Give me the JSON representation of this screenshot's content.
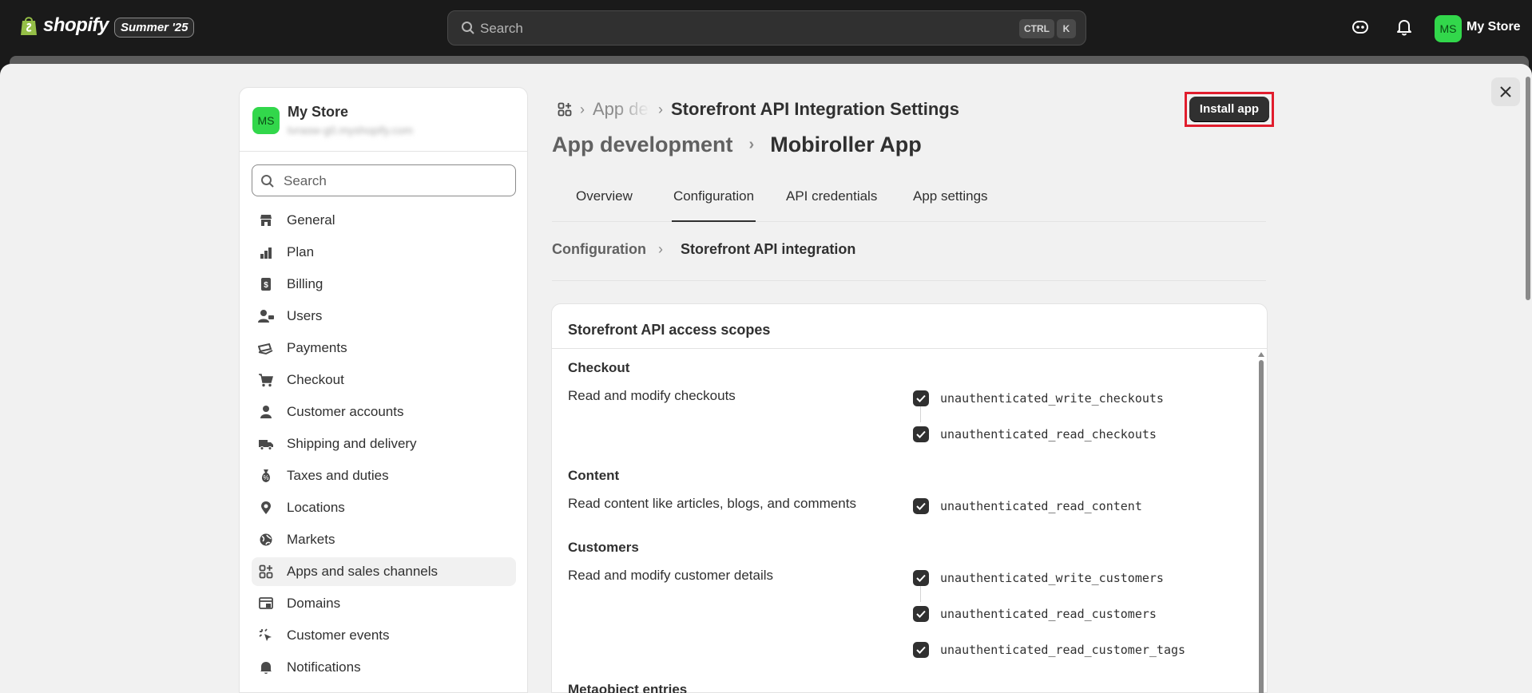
{
  "topbar": {
    "logo_text": "shopify",
    "edition_badge": "Summer '25",
    "search_placeholder": "Search",
    "shortcut_ctrl": "CTRL",
    "shortcut_k": "K",
    "avatar_initials": "MS",
    "store_name": "My Store"
  },
  "sidebar": {
    "avatar_initials": "MS",
    "store_name": "My Store",
    "store_url": "tvrasw-g0.myshopify.com",
    "search_placeholder": "Search",
    "items": [
      {
        "label": "General",
        "icon": "store-icon"
      },
      {
        "label": "Plan",
        "icon": "plan-icon"
      },
      {
        "label": "Billing",
        "icon": "billing-icon"
      },
      {
        "label": "Users",
        "icon": "users-icon"
      },
      {
        "label": "Payments",
        "icon": "payments-icon"
      },
      {
        "label": "Checkout",
        "icon": "cart-icon"
      },
      {
        "label": "Customer accounts",
        "icon": "person-icon"
      },
      {
        "label": "Shipping and delivery",
        "icon": "truck-icon"
      },
      {
        "label": "Taxes and duties",
        "icon": "taxes-icon"
      },
      {
        "label": "Locations",
        "icon": "location-icon"
      },
      {
        "label": "Markets",
        "icon": "globe-icon"
      },
      {
        "label": "Apps and sales channels",
        "icon": "apps-icon",
        "active": true
      },
      {
        "label": "Domains",
        "icon": "domains-icon"
      },
      {
        "label": "Customer events",
        "icon": "cursor-icon"
      },
      {
        "label": "Notifications",
        "icon": "bell-icon"
      }
    ]
  },
  "header": {
    "crumb_faded": "App development",
    "crumb_current": "Storefront API Integration Settings",
    "install_label": "Install app",
    "title_parent": "App development",
    "title_app": "Mobiroller App"
  },
  "tabs": [
    {
      "label": "Overview"
    },
    {
      "label": "Configuration",
      "active": true
    },
    {
      "label": "API credentials"
    },
    {
      "label": "App settings"
    }
  ],
  "subcrumb": {
    "parent": "Configuration",
    "current": "Storefront API integration"
  },
  "card": {
    "title": "Storefront API access scopes",
    "sections": [
      {
        "title": "Checkout",
        "description": "Read and modify checkouts",
        "scopes": [
          {
            "name": "unauthenticated_write_checkouts",
            "checked": true
          },
          {
            "name": "unauthenticated_read_checkouts",
            "checked": true
          }
        ]
      },
      {
        "title": "Content",
        "description": "Read content like articles, blogs, and comments",
        "scopes": [
          {
            "name": "unauthenticated_read_content",
            "checked": true
          }
        ]
      },
      {
        "title": "Customers",
        "description": "Read and modify customer details",
        "scopes": [
          {
            "name": "unauthenticated_write_customers",
            "checked": true
          },
          {
            "name": "unauthenticated_read_customers",
            "checked": true
          },
          {
            "name": "unauthenticated_read_customer_tags",
            "checked": true
          }
        ]
      },
      {
        "title": "Metaobject entries",
        "description": "",
        "scopes": []
      }
    ]
  }
}
